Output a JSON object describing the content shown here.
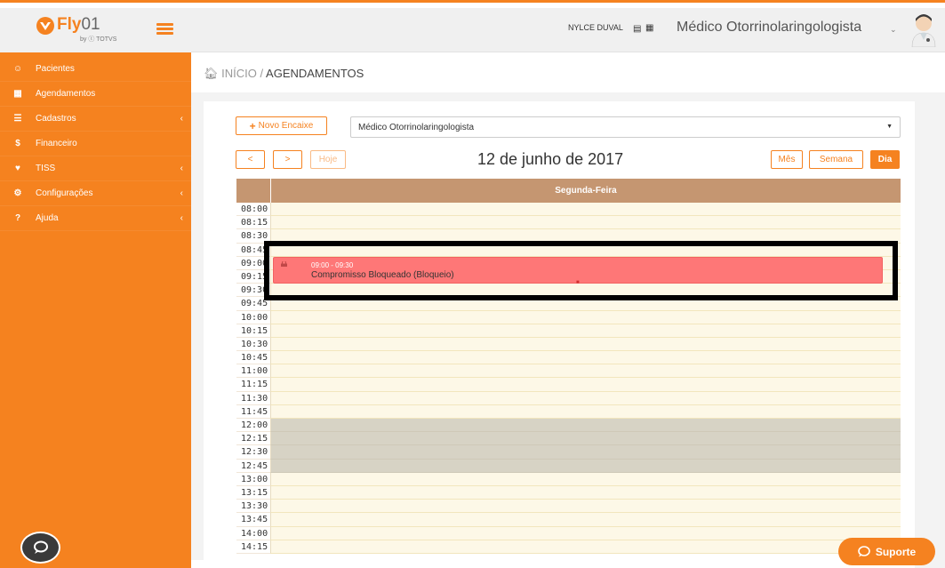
{
  "app": {
    "brand": "Fly",
    "brand_suffix": "01",
    "brand_sub": "by ⓣ TOTVS",
    "accent_color": "#f58220"
  },
  "sidebar": {
    "items": [
      {
        "label": "Pacientes",
        "icon": "users-icon",
        "has_chevron": false
      },
      {
        "label": "Agendamentos",
        "icon": "calendar-icon",
        "has_chevron": false
      },
      {
        "label": "Cadastros",
        "icon": "list-icon",
        "has_chevron": true
      },
      {
        "label": "Financeiro",
        "icon": "dollar-icon",
        "has_chevron": false
      },
      {
        "label": "TISS",
        "icon": "heartbeat-icon",
        "has_chevron": true
      },
      {
        "label": "Configurações",
        "icon": "gear-icon",
        "has_chevron": true
      },
      {
        "label": "Ajuda",
        "icon": "question-icon",
        "has_chevron": true
      }
    ],
    "chevron": "‹"
  },
  "header": {
    "user_name": "NYLCE DUVAL",
    "role": "Médico Otorrinolaringologista",
    "role_chevron": "⌄"
  },
  "breadcrumb": {
    "home": "INÍCIO",
    "separator": "/",
    "current": "AGENDAMENTOS"
  },
  "toolbar": {
    "new_fit_in": "Novo Encaixe",
    "doctor_select_value": "Médico Otorrinolaringologista",
    "prev": "<",
    "next": ">",
    "today": "Hoje",
    "date_title": "12 de junho de 2017",
    "view_month": "Mês",
    "view_week": "Semana",
    "view_day": "Dia",
    "active_view": "Dia"
  },
  "calendar": {
    "day_header": "Segunda-Feira",
    "times": [
      "08:00",
      "08:15",
      "08:30",
      "08:45",
      "09:00",
      "09:15",
      "09:30",
      "09:45",
      "10:00",
      "10:15",
      "10:30",
      "10:45",
      "11:00",
      "11:15",
      "11:30",
      "11:45",
      "12:00",
      "12:15",
      "12:30",
      "12:45",
      "13:00",
      "13:15",
      "13:30",
      "13:45",
      "14:00",
      "14:15"
    ],
    "lunch_times": [
      "12:00",
      "12:15",
      "12:30",
      "12:45"
    ],
    "events": [
      {
        "time": "09:00 - 09:30",
        "title": "Compromisso Bloqueado (Bloqueio)",
        "color": "#fe7777"
      }
    ]
  },
  "support": {
    "label": "Suporte"
  }
}
